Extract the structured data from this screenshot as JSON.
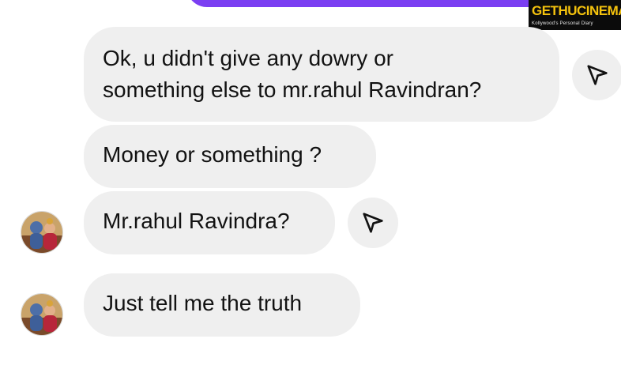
{
  "watermark": {
    "title": "GETHUCINEMA",
    "subtitle": "Kollywood's Personal Diary"
  },
  "messages": [
    {
      "lines": [
        "Ok, u didn't give any dowry or",
        "something else to mr.rahul Ravindran?"
      ]
    },
    {
      "lines": [
        "Money or something ?"
      ]
    },
    {
      "lines": [
        "Mr.rahul Ravindra?"
      ]
    },
    {
      "lines": [
        "Just tell me the truth"
      ]
    }
  ],
  "icons": {
    "share": "paper-plane-share-icon",
    "avatar": "profile-avatar"
  },
  "colors": {
    "sent_bubble": "#7b3ff2",
    "received_bubble": "#efefef",
    "text": "#121212",
    "watermark_bg": "#0b0b0b",
    "watermark_accent": "#f4c20d"
  }
}
